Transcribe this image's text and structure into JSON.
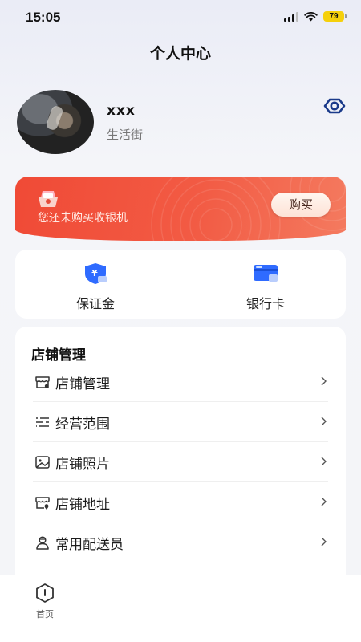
{
  "status_bar": {
    "time": "15:05",
    "battery": "79"
  },
  "header": {
    "title": "个人中心"
  },
  "profile": {
    "name": "xxx",
    "subtitle": "生活街",
    "visibility_icon": "eye-icon"
  },
  "banner": {
    "text": "您还未购买收银机",
    "button_label": "购买",
    "gift_icon": "gift-icon"
  },
  "quick_entries": [
    {
      "label": "保证金",
      "icon": "shield-yuan-icon",
      "color": "#2f6bff"
    },
    {
      "label": "银行卡",
      "icon": "bank-card-icon",
      "color": "#2f6bff"
    }
  ],
  "menu": {
    "title": "店铺管理",
    "items": [
      {
        "label": "店铺管理",
        "icon": "store-icon"
      },
      {
        "label": "经营范围",
        "icon": "sliders-icon"
      },
      {
        "label": "店铺照片",
        "icon": "photo-icon"
      },
      {
        "label": "店铺地址",
        "icon": "store-location-icon"
      },
      {
        "label": "常用配送员",
        "icon": "courier-icon"
      }
    ]
  },
  "tabbar": {
    "home_label": "首页",
    "home_icon": "home-hexagon-icon"
  },
  "colors": {
    "accent": "#f04a36",
    "brand_blue": "#2f6bff",
    "background": "#f4f5f8"
  }
}
